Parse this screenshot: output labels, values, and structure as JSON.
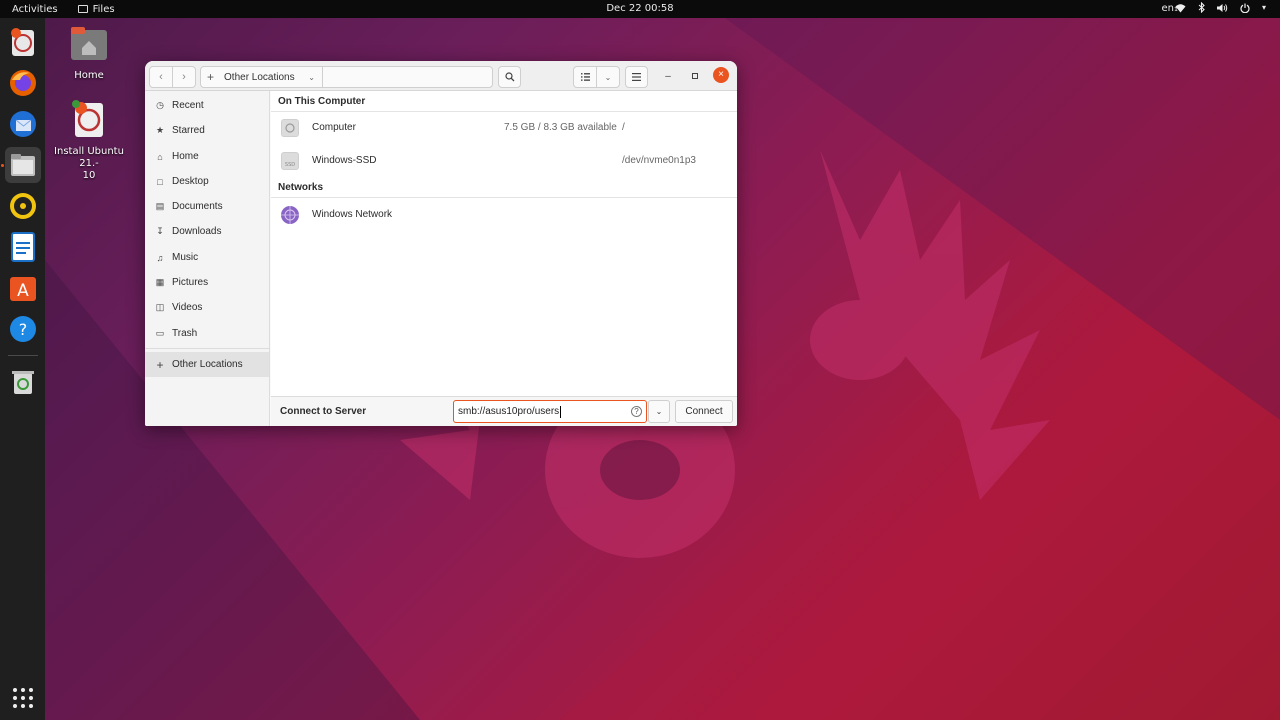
{
  "topbar": {
    "activities": "Activities",
    "app_name": "Files",
    "clock": "Dec 22  00:58",
    "language": "en₁"
  },
  "desktop": {
    "home_label": "Home",
    "installer_label": "Install Ubuntu 21.-\n10"
  },
  "dock": {
    "apps": [
      "ubuntu-installer-icon",
      "firefox-icon",
      "thunderbird-icon",
      "files-icon",
      "rhythmbox-icon",
      "libreoffice-writer-icon",
      "ubuntu-software-icon",
      "help-icon",
      "trash-icon",
      "show-apps-icon"
    ]
  },
  "window": {
    "location": "Other Locations",
    "search_placeholder": "",
    "sidebar": {
      "items": [
        {
          "label": "Recent",
          "icon": "clock-icon"
        },
        {
          "label": "Starred",
          "icon": "star-icon"
        },
        {
          "label": "Home",
          "icon": "home-icon"
        },
        {
          "label": "Desktop",
          "icon": "desktop-icon"
        },
        {
          "label": "Documents",
          "icon": "document-icon"
        },
        {
          "label": "Downloads",
          "icon": "download-icon"
        },
        {
          "label": "Music",
          "icon": "music-icon"
        },
        {
          "label": "Pictures",
          "icon": "picture-icon"
        },
        {
          "label": "Videos",
          "icon": "video-icon"
        },
        {
          "label": "Trash",
          "icon": "trash-icon"
        },
        {
          "label": "Other Locations",
          "icon": "plus-icon"
        }
      ]
    },
    "on_this_computer": {
      "title": "On This Computer",
      "rows": [
        {
          "name": "Computer",
          "info": "7.5 GB / 8.3 GB available",
          "path": "/"
        },
        {
          "name": "Windows-SSD",
          "info": "",
          "path": "/dev/nvme0n1p3"
        }
      ]
    },
    "networks": {
      "title": "Networks",
      "rows": [
        {
          "name": "Windows Network"
        }
      ]
    },
    "footer": {
      "label": "Connect to Server",
      "server_address": "smb://asus10pro/users",
      "connect_label": "Connect"
    }
  },
  "colors": {
    "accent": "#e95420",
    "topbar": "#0b0b0b",
    "dock": "#1f1f1f"
  }
}
